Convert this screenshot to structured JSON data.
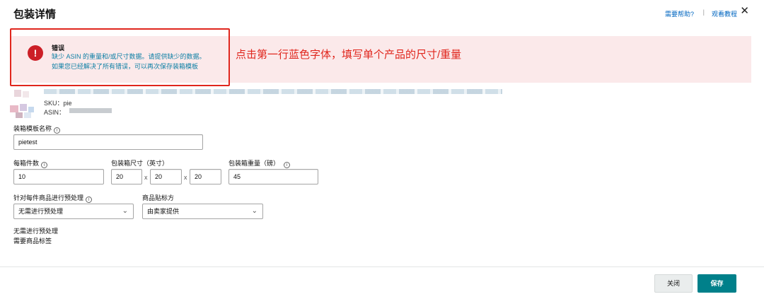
{
  "header": {
    "title": "包装详情",
    "help_link": "需要帮助?",
    "separator": "|",
    "tutorial_link": "观看教程",
    "close_glyph": "✕"
  },
  "error": {
    "icon": "!",
    "title": "错误",
    "line1": "缺少 ASIN 的重量和/或尺寸数据。请提供缺少的数据。",
    "line2": "如果您已经解决了所有错误，可以再次保存装箱模板"
  },
  "annotation": "点击第一行蓝色字体，填写单个产品的尺寸/重量",
  "product": {
    "sku": "SKU：pie",
    "asin_label": "ASIN："
  },
  "form": {
    "template_name_label": "装箱模板名称",
    "template_name_value": "pietest",
    "units_per_box_label": "每箱件数",
    "units_per_box_value": "10",
    "box_dims_label": "包装箱尺寸（英寸）",
    "box_dim_l": "20",
    "box_dim_w": "20",
    "box_dim_h": "20",
    "dim_sep": "x",
    "box_weight_label": "包装箱重量（磅）",
    "box_weight_value": "45",
    "prep_label": "针对每件商品进行预处理",
    "prep_value": "无需进行预处理",
    "labeling_label": "商品贴标方",
    "labeling_value": "由卖家提供",
    "info_glyph": "i"
  },
  "summary": {
    "prep_text": "无需进行预处理",
    "label_text": "需要商品标签"
  },
  "footer": {
    "close_label": "关闭",
    "save_label": "保存"
  },
  "colors": {
    "error_red": "#e0261d",
    "link_blue": "#0066c0",
    "error_text": "#0d7fa5",
    "save_teal": "#00808a"
  }
}
